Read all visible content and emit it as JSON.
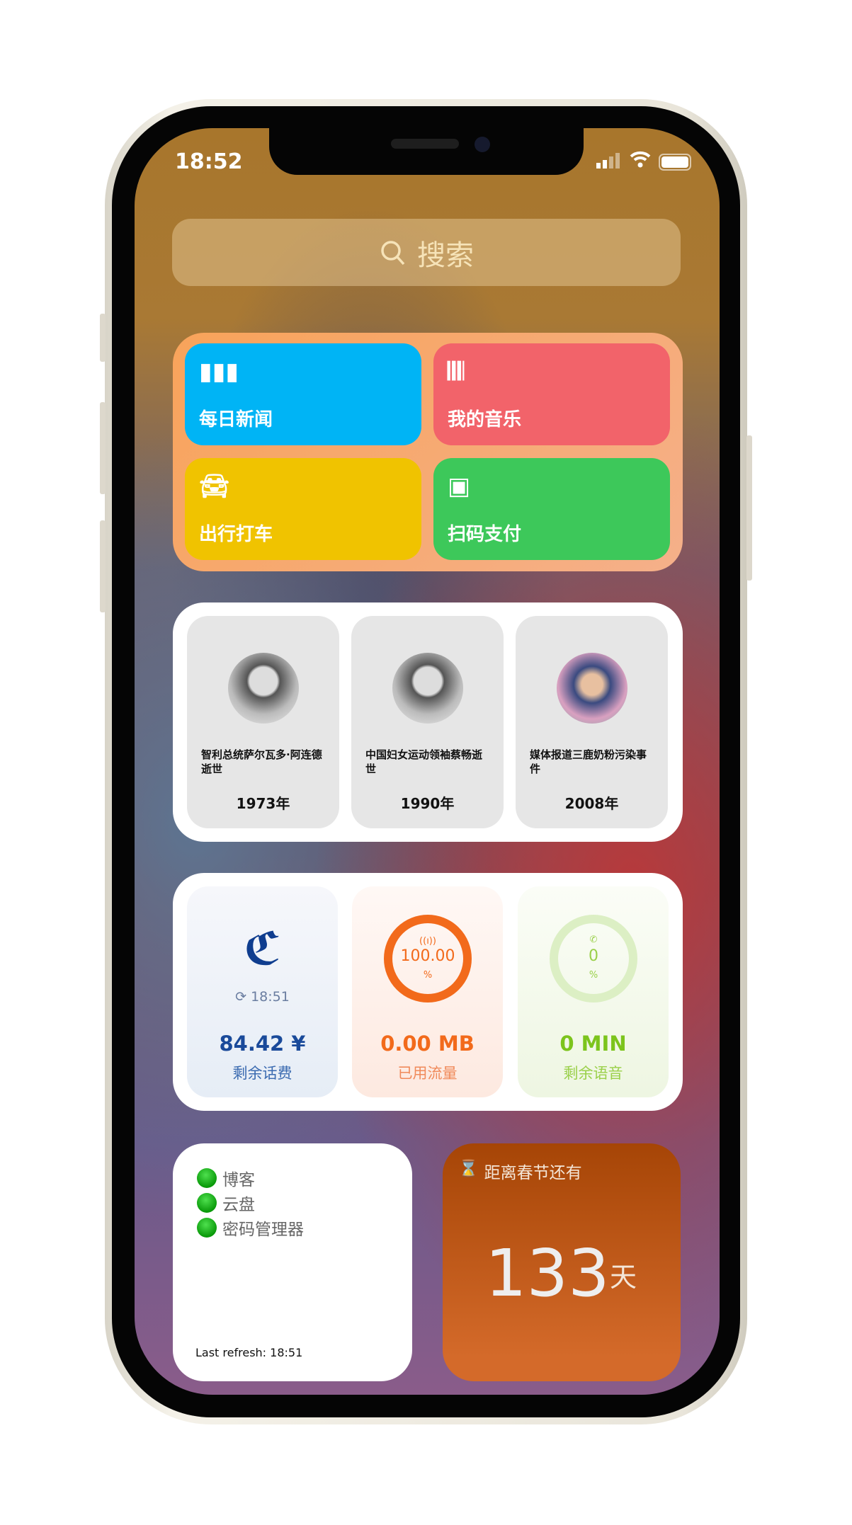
{
  "status_bar": {
    "time": "18:52"
  },
  "search": {
    "placeholder": "搜索"
  },
  "shortcuts": [
    {
      "label": "每日新闻",
      "icon": "bar-chart-icon",
      "color": "#00b4f5"
    },
    {
      "label": "我的音乐",
      "icon": "waveform-icon",
      "color": "#f2636a"
    },
    {
      "label": "出行打车",
      "icon": "car-icon",
      "color": "#f0c300"
    },
    {
      "label": "扫码支付",
      "icon": "qr-code-icon",
      "color": "#3dc85a"
    }
  ],
  "history": [
    {
      "title": "智利总统萨尔瓦多·阿连德逝世",
      "year": "1973年"
    },
    {
      "title": "中国妇女运动领袖蔡畅逝世",
      "year": "1990年"
    },
    {
      "title": "媒体报道三鹿奶粉污染事件",
      "year": "2008年"
    }
  ],
  "telecom": {
    "refresh_time": "18:51",
    "balance": "84.42 ¥",
    "balance_label": "剩余话费",
    "data_percent": "100.00",
    "percent_sign": "%",
    "data_used": "0.00 MB",
    "data_label": "已用流量",
    "voice_percent": "0",
    "voice_remaining": "0 MIN",
    "voice_label": "剩余语音",
    "colors": {
      "blue": "#1a4a9a",
      "orange": "#f26a1b",
      "green": "#7cc41c"
    }
  },
  "services": {
    "items": [
      "博客",
      "云盘",
      "密码管理器"
    ],
    "last_refresh": "Last refresh: 18:51"
  },
  "countdown": {
    "title": "距离春节还有",
    "days": "133",
    "unit": "天"
  }
}
